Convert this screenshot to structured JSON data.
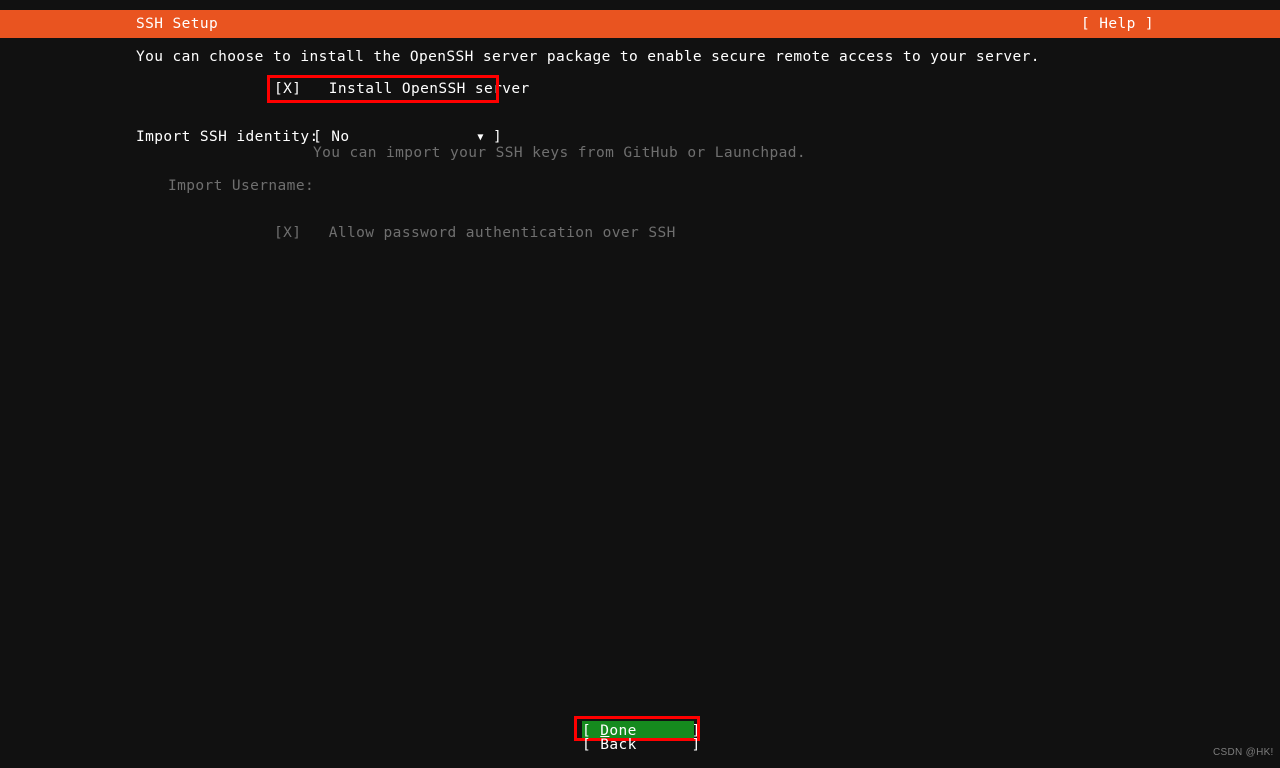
{
  "header": {
    "title": "SSH Setup",
    "help_label": "[ Help ]",
    "bar_color": "#e95420"
  },
  "main": {
    "intro_text": "You can choose to install the OpenSSH server package to enable secure remote access to your server.",
    "install_checkbox": {
      "marker": "[X]",
      "label": "Install OpenSSH server",
      "full_text": "[X]   Install OpenSSH server",
      "checked": true,
      "focused": true
    },
    "import_identity": {
      "label": "Import SSH identity:",
      "open_bracket": "[",
      "value": "No",
      "arrow_icon": "▼",
      "close_bracket": "]",
      "help_text": "You can import your SSH keys from GitHub or Launchpad."
    },
    "import_username": {
      "label": "Import Username:",
      "value": "",
      "disabled": true
    },
    "password_auth_checkbox": {
      "marker": "[X]",
      "label": "Allow password authentication over SSH",
      "full_text": "[X]   Allow password authentication over SSH",
      "checked": true,
      "disabled": true
    }
  },
  "footer": {
    "done_button": {
      "open_bracket": "[",
      "accel": "D",
      "rest": "one",
      "close_bracket": "]",
      "selected": true,
      "highlight_color": "#158a1e"
    },
    "back_button": {
      "full_text": "[ Back      ]"
    }
  },
  "annotations": {
    "box_color": "#ff0000",
    "targets": [
      "install-openssh-checkbox",
      "done-button"
    ]
  },
  "watermark": {
    "text": "CSDN @HK!"
  }
}
